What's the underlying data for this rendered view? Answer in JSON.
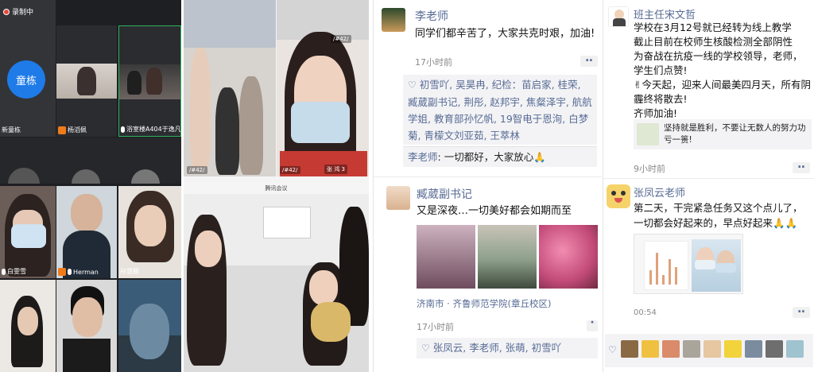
{
  "meeting": {
    "recording_label": "录制中",
    "avatar_initials": "童栋",
    "participants": [
      "新童栋",
      "杨滔佩",
      "浴室楼A404于逸凡",
      "白雯雪",
      "Herman",
      "孙慧颖"
    ]
  },
  "collage": {
    "tags": [
      "/#42/",
      "/#42/",
      "/#42/",
      "张 鸿 3"
    ],
    "caption": "腾讯会议"
  },
  "post1": {
    "author": "李老师",
    "text": "同学们都辛苦了，大家共克时艰，加油!",
    "time": "17小时前",
    "likes": "初雪吖, 吴昊冉, 纪检：苗启家, 桂荣, 臧葳副书记, 荆彤, 赵邦宇, 焦粲泽宇, 航航学姐, 教育部孙忆帆, 19智电于恩洵, 白梦菊, 青檬文刘亚茹, 王萃林",
    "comment_author": "李老师",
    "comment_text": "一切都好，大家放心🙏"
  },
  "post2": {
    "author": "臧葳副书记",
    "text": "又是深夜…一切美好都会如期而至",
    "location": "济南市 · 齐鲁师范学院(章丘校区)",
    "time": "17小时前",
    "likes": "张凤云, 李老师, 张萌, 初雪吖"
  },
  "post3": {
    "author": "班主任宋文哲",
    "lines": [
      "学校在3月12号就已经转为线上教学",
      "截止目前在校师生核酸检测全部阴性",
      "为奋战在抗疫一线的学校领导，老师，学生们点赞!",
      "✌今天起，迎来人间最美四月天，所有阴霾终将散去!",
      "齐师加油!"
    ],
    "link_text": "坚持就是胜利，不要让无数人的努力功亏一篑!",
    "time": "9小时前"
  },
  "post4": {
    "author": "张凤云老师",
    "text": "第二天，干完紧急任务又这个点儿了，一切都会好起来的，早点好起来🙏🙏",
    "video_duration": "00:54"
  },
  "icons": [
    "record-dot",
    "microphone",
    "host-badge",
    "heart",
    "more-dots"
  ],
  "colors": {
    "link_blue": "#576b95",
    "meeting_bg": "#1e1f22",
    "avatar_blue": "#1e7be8",
    "record_red": "#e5483a",
    "host_orange": "#f07b1a"
  }
}
